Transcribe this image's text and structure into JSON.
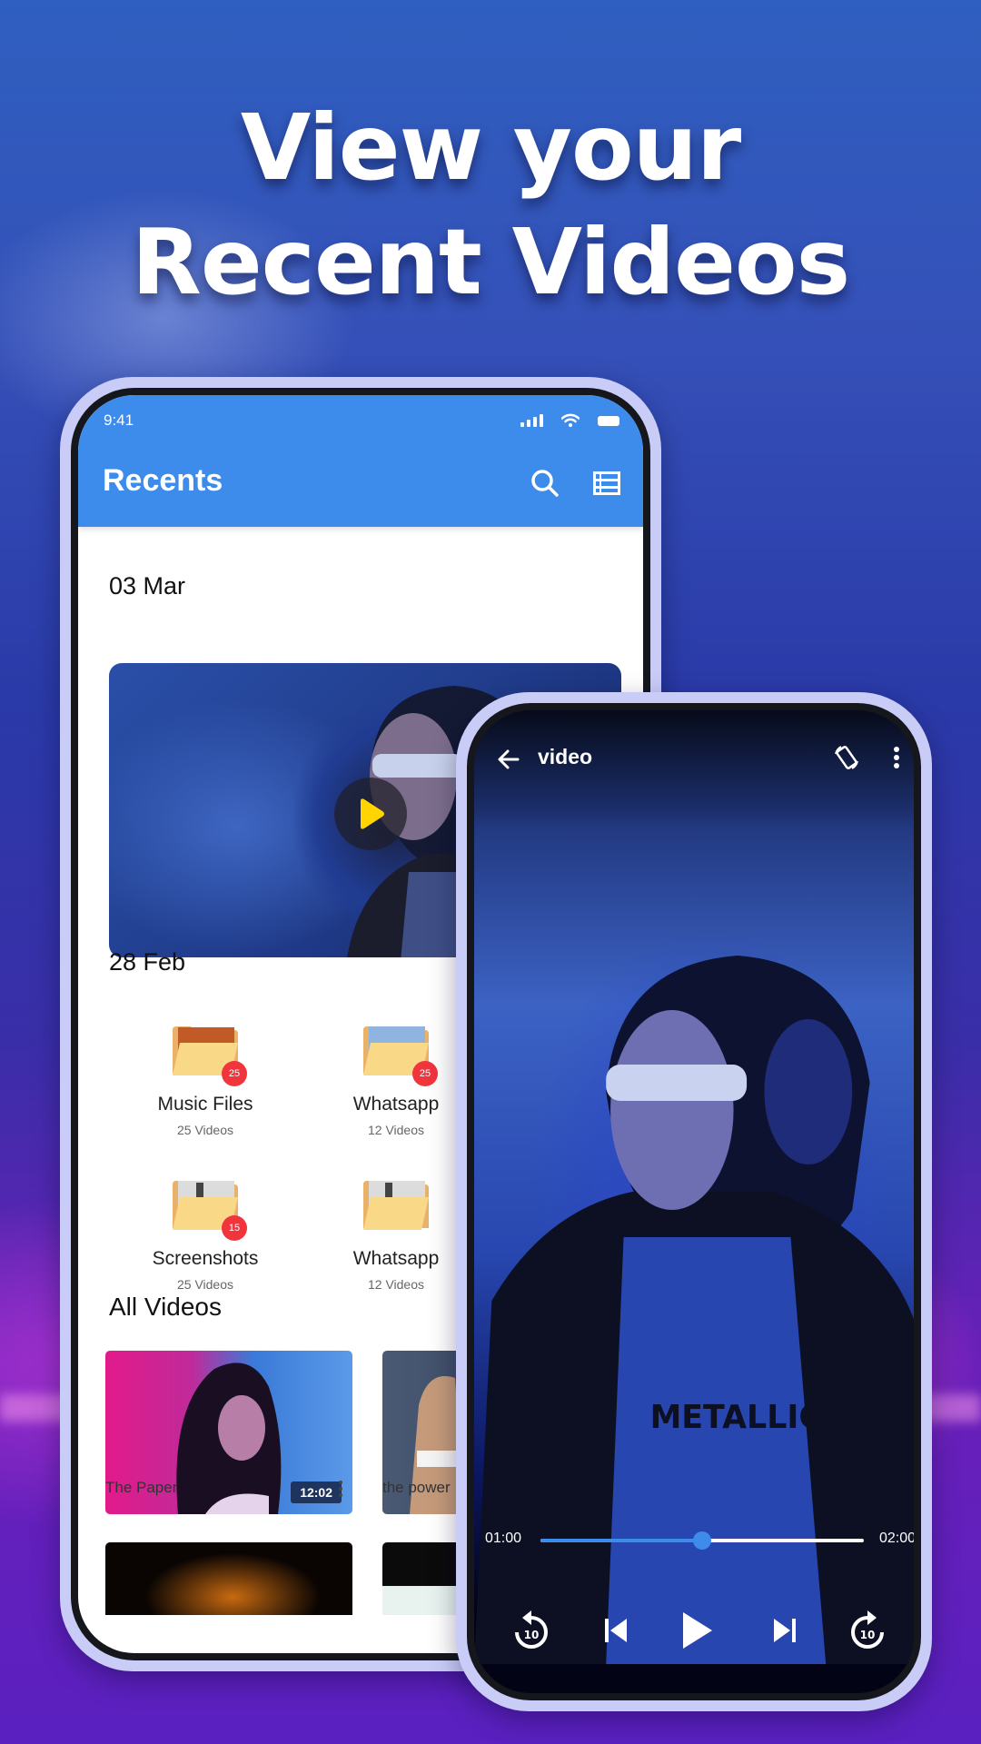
{
  "headline": {
    "line1": "View your",
    "line2": "Recent Videos"
  },
  "left_phone": {
    "status_bar": {
      "time": "9:41",
      "icons": [
        "signal-icon",
        "wifi-icon",
        "battery-icon"
      ]
    },
    "app_bar": {
      "title": "Recents",
      "actions": [
        "search-icon",
        "list-view-icon"
      ]
    },
    "accent_color": "#3d8bea",
    "sections": {
      "recent_date": "03 Mar",
      "hero_video": {
        "play_icon": "play-icon",
        "play_color": "#ffd400"
      },
      "folder_date": "28 Feb",
      "folders": [
        {
          "name": "Music Files",
          "count": "25 Videos",
          "badge": "25"
        },
        {
          "name": "Whatsapp",
          "count": "12 Videos",
          "badge": "25"
        },
        {
          "name": "Screenshots",
          "count": "25 Videos",
          "badge": "15"
        },
        {
          "name": "Whatsapp",
          "count": "12 Videos",
          "badge": ""
        }
      ],
      "all_videos_title": "All Videos",
      "videos": [
        {
          "title": "The Paper",
          "duration": "12:02"
        },
        {
          "title": "the power",
          "duration": ""
        }
      ]
    },
    "badge_color": "#f0353d"
  },
  "right_phone": {
    "top_bar": {
      "title": "video",
      "actions": [
        "back-arrow-icon",
        "screen-rotate-icon",
        "more-vertical-icon"
      ]
    },
    "playback": {
      "current_time": "01:00",
      "total_time": "02:00",
      "progress_fraction": 0.5
    },
    "controls": [
      "replay-10-icon",
      "skip-previous-icon",
      "play-icon",
      "skip-next-icon",
      "forward-10-icon"
    ],
    "replay_seconds": "10",
    "forward_seconds": "10"
  }
}
